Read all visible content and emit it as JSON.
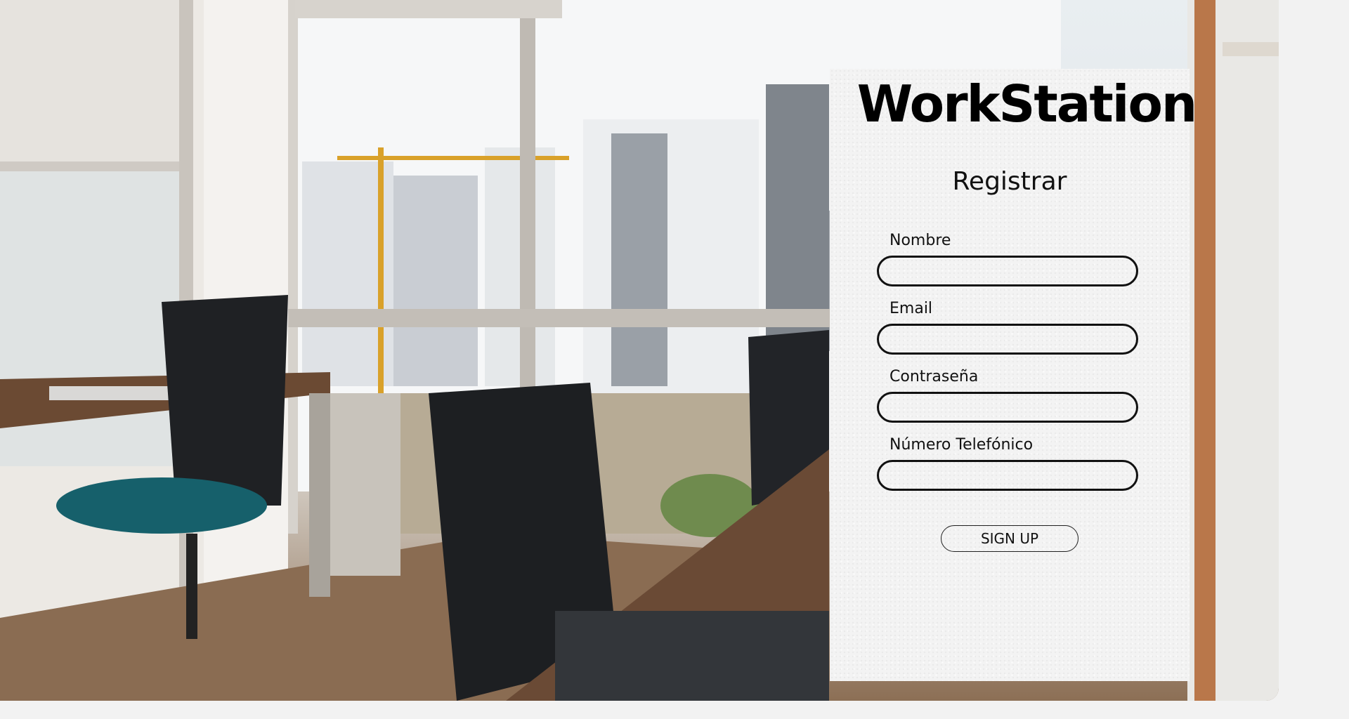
{
  "brand": {
    "name": "WorkStation"
  },
  "form": {
    "title": "Registrar",
    "fields": [
      {
        "label": "Nombre",
        "value": "",
        "placeholder": ""
      },
      {
        "label": "Email",
        "value": "",
        "placeholder": ""
      },
      {
        "label": "Contraseña",
        "value": "",
        "placeholder": ""
      },
      {
        "label": "Número Telefónico",
        "value": "",
        "placeholder": ""
      }
    ],
    "submit_label": "SIGN UP"
  },
  "colors": {
    "page_background": "#f2f2f2",
    "panel_background": "#f3f3f3",
    "text": "#000000",
    "input_border": "#111111"
  }
}
